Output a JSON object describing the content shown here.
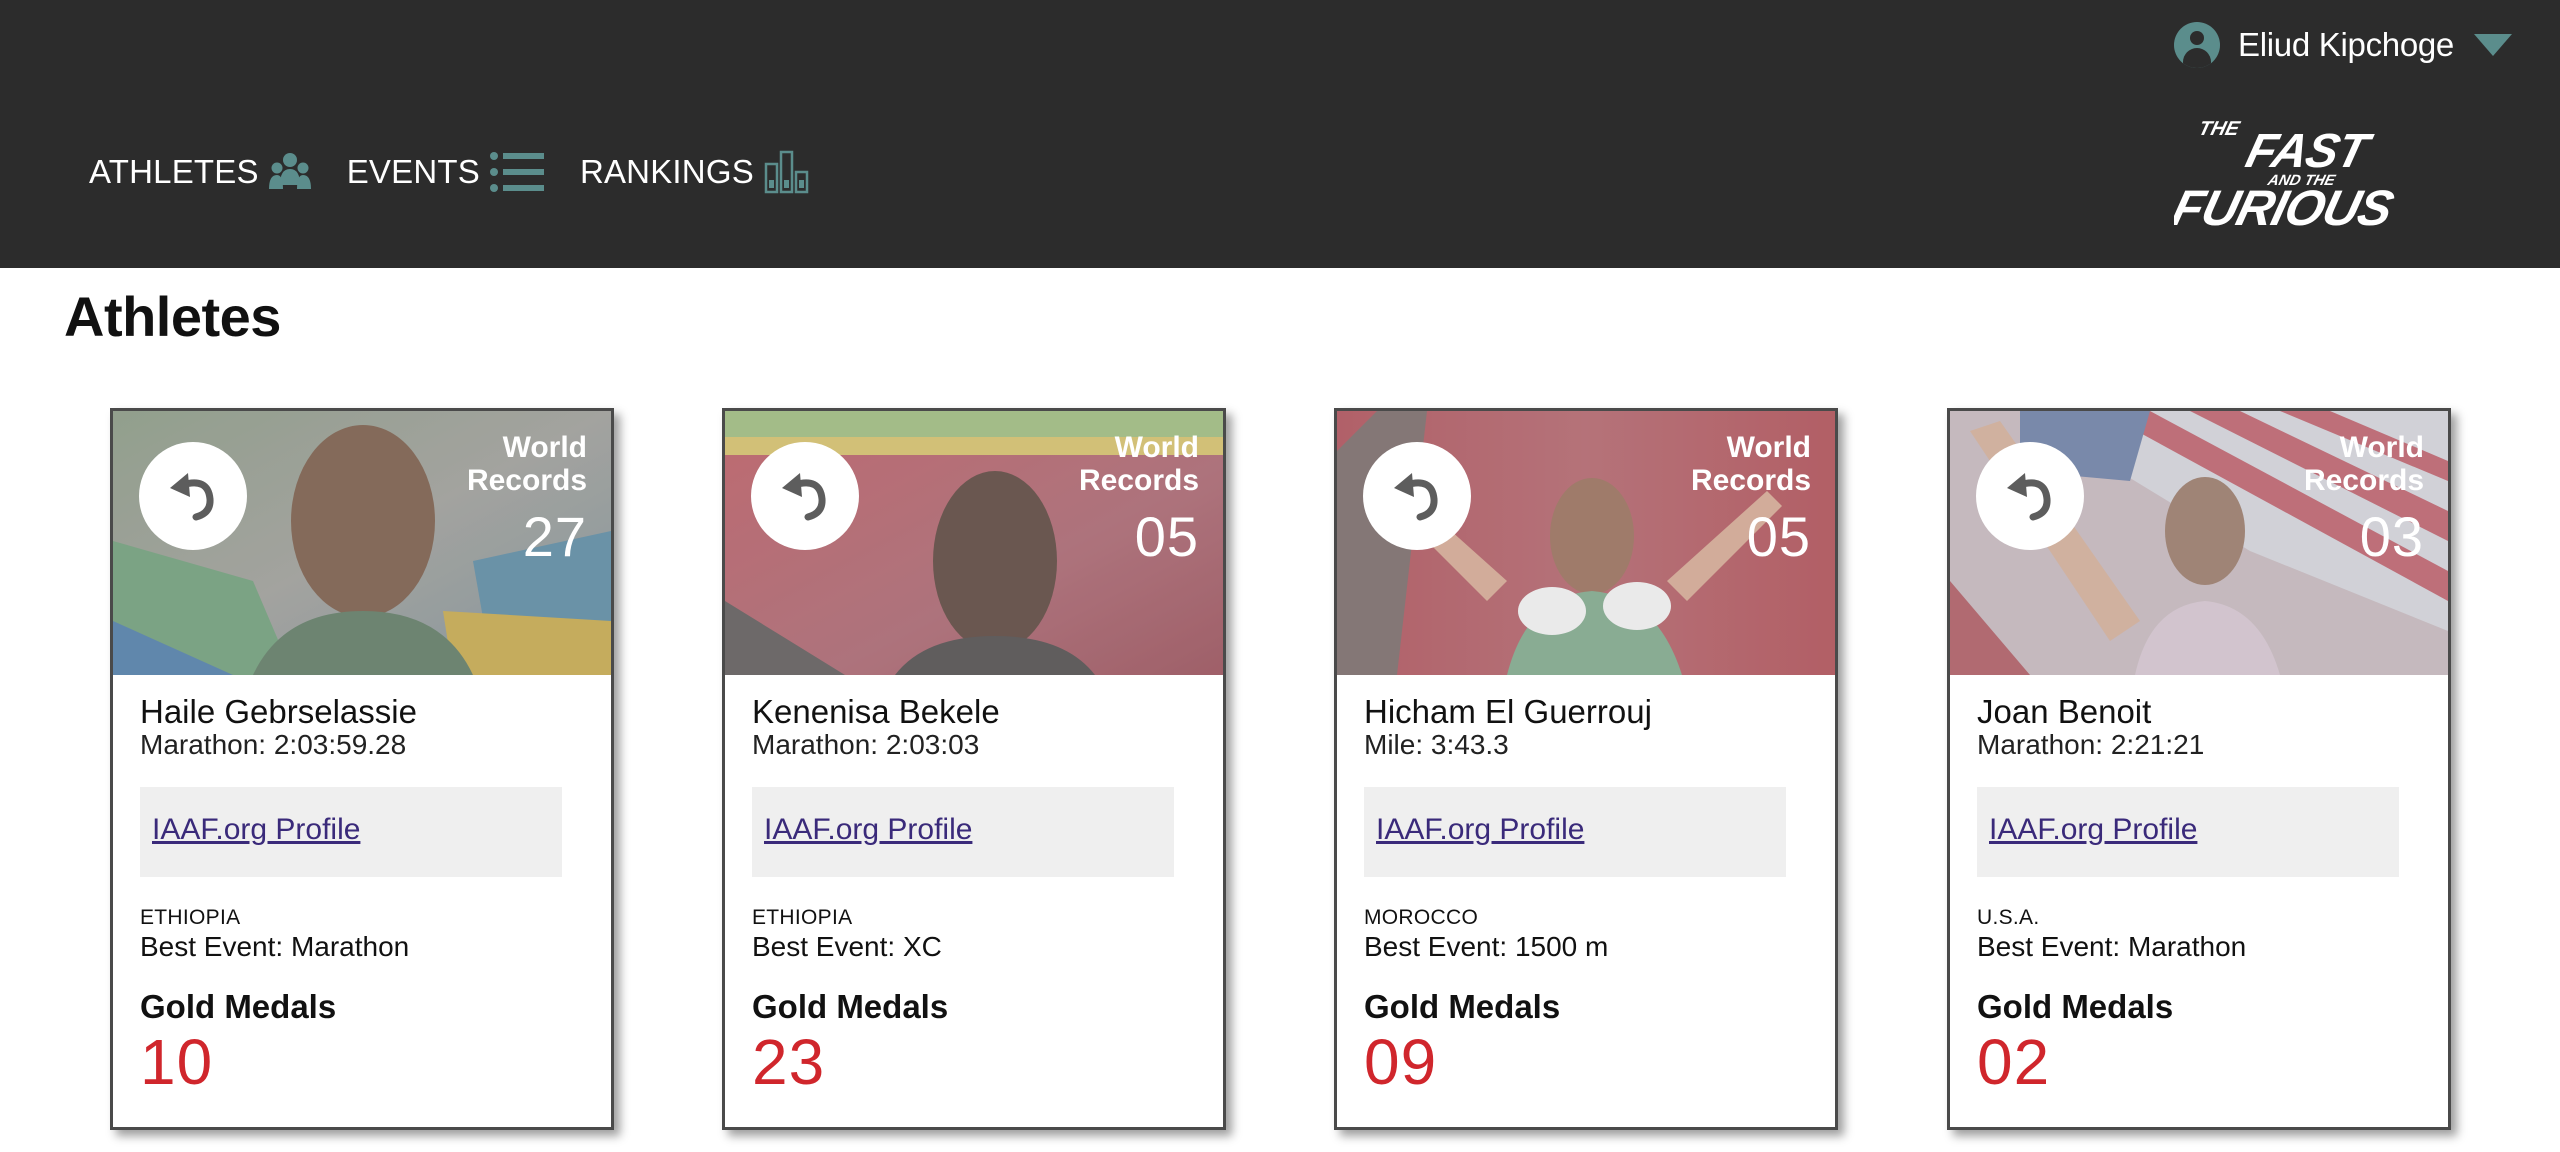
{
  "header": {
    "user_name": "Eliud Kipchoge",
    "nav": [
      {
        "label": "ATHLETES",
        "icon": "athletes-group-icon"
      },
      {
        "label": "EVENTS",
        "icon": "list-icon"
      },
      {
        "label": "RANKINGS",
        "icon": "bar-chart-icon"
      }
    ],
    "logo": {
      "line1": "THE",
      "line2": "FAST",
      "line3": "AND THE",
      "line4": "FURIOUS"
    }
  },
  "page": {
    "title": "Athletes"
  },
  "card_common": {
    "world_records_label_1": "World",
    "world_records_label_2": "Records",
    "profile_link_label": "IAAF.org Profile",
    "gold_medals_label": "Gold Medals",
    "flip_icon": "undo-arrow-icon"
  },
  "athletes": [
    {
      "name": "Haile Gebrselassie",
      "pb": "Marathon: 2:03:59.28",
      "country": "ETHIOPIA",
      "best_event": "Best Event: Marathon",
      "world_records": "27",
      "gold_medals": "10"
    },
    {
      "name": "Kenenisa Bekele",
      "pb": "Marathon: 2:03:03",
      "country": "ETHIOPIA",
      "best_event": "Best Event: XC",
      "world_records": "05",
      "gold_medals": "23"
    },
    {
      "name": "Hicham El Guerrouj",
      "pb": "Mile: 3:43.3",
      "country": "MOROCCO",
      "best_event": "Best Event: 1500 m",
      "world_records": "05",
      "gold_medals": "09"
    },
    {
      "name": "Joan Benoit",
      "pb": "Marathon: 2:21:21",
      "country": "U.S.A.",
      "best_event": "Best Event: Marathon",
      "world_records": "03",
      "gold_medals": "02"
    }
  ],
  "colors": {
    "header_bg": "#2c2c2c",
    "accent_teal": "#5b8d8c",
    "gold_medal_number": "#d0262c",
    "link": "#3a2a7a",
    "profile_box_bg": "#efefef"
  }
}
